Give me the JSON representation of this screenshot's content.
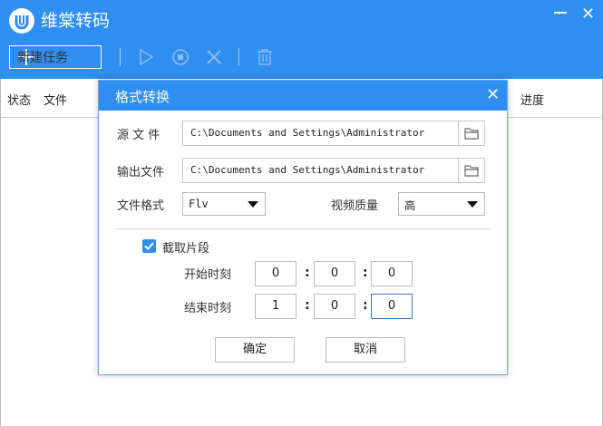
{
  "app": {
    "title": "维棠转码",
    "colors": {
      "accent": "#2f8ef1"
    }
  },
  "toolbar": {
    "new_task_label": "新建任务",
    "icons": [
      "play-icon",
      "stop-icon",
      "delete-x-icon",
      "trash-icon"
    ]
  },
  "table": {
    "columns": {
      "status": "状态",
      "file": "文件",
      "progress": "进度"
    }
  },
  "dialog": {
    "title": "格式转换",
    "source_label": "源 文 件",
    "source_value": "C:\\Documents and Settings\\Administrator",
    "output_label": "输出文件",
    "output_value": "C:\\Documents and Settings\\Administrator",
    "format_label": "文件格式",
    "format_value": "Flv",
    "quality_label": "视频质量",
    "quality_value": "高",
    "clip_label": "截取片段",
    "clip_checked": true,
    "start_label": "开始时刻",
    "start": [
      "0",
      "0",
      "0"
    ],
    "end_label": "结束时刻",
    "end": [
      "1",
      "0",
      "0"
    ],
    "colon": ":",
    "ok_label": "确定",
    "cancel_label": "取消"
  }
}
